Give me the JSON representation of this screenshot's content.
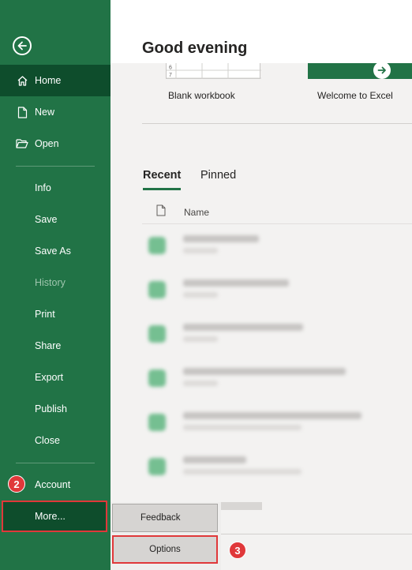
{
  "sidebar": {
    "items": [
      {
        "label": "Home"
      },
      {
        "label": "New"
      },
      {
        "label": "Open"
      },
      {
        "label": "Info"
      },
      {
        "label": "Save"
      },
      {
        "label": "Save As"
      },
      {
        "label": "History"
      },
      {
        "label": "Print"
      },
      {
        "label": "Share"
      },
      {
        "label": "Export"
      },
      {
        "label": "Publish"
      },
      {
        "label": "Close"
      },
      {
        "label": "Account"
      },
      {
        "label": "More..."
      }
    ],
    "bg_color": "#217346",
    "active_color": "#0e4d2c"
  },
  "main": {
    "greeting": "Good evening",
    "templates": [
      {
        "label": "Blank workbook",
        "row_numbers": [
          "6",
          "7"
        ]
      },
      {
        "label": "Welcome to Excel"
      }
    ],
    "tabs": [
      {
        "label": "Recent"
      },
      {
        "label": "Pinned"
      }
    ],
    "column_header": "Name"
  },
  "flyout": {
    "feedback_label": "Feedback",
    "options_label": "Options"
  },
  "annotations": {
    "step2": "2",
    "step3": "3",
    "highlight_color": "#e0383a"
  }
}
